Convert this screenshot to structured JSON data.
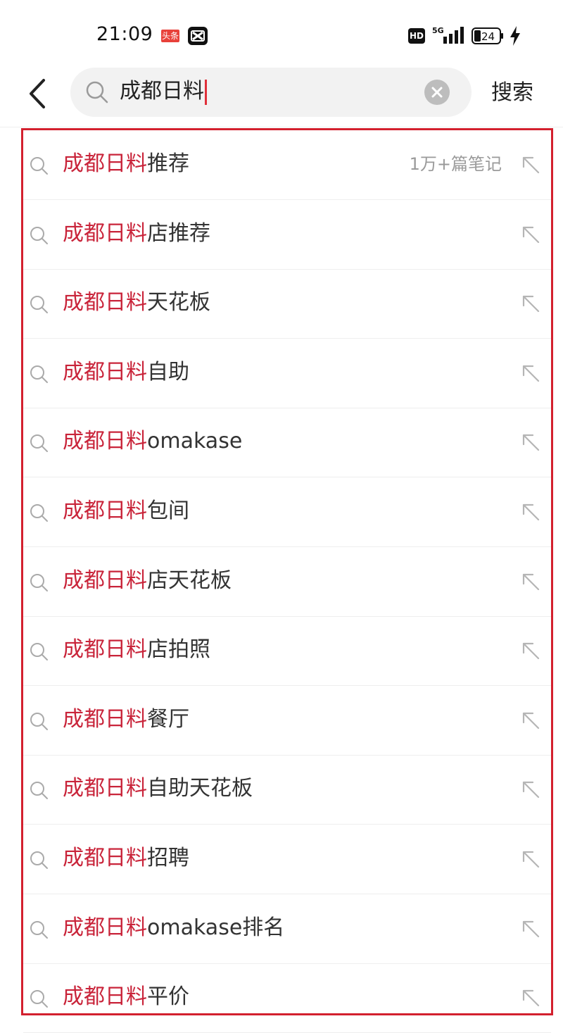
{
  "status_bar": {
    "time": "21:09",
    "toutiao_badge": "头条",
    "network": "5G",
    "hd": "HD",
    "battery": "24"
  },
  "search": {
    "query": "成都日料",
    "button_label": "搜索"
  },
  "suggestions": [
    {
      "highlight": "成都日料",
      "rest": "推荐",
      "count": "1万+篇笔记"
    },
    {
      "highlight": "成都日料",
      "rest": "店推荐",
      "count": ""
    },
    {
      "highlight": "成都日料",
      "rest": "天花板",
      "count": ""
    },
    {
      "highlight": "成都日料",
      "rest": "自助",
      "count": ""
    },
    {
      "highlight": "成都日料",
      "rest": "omakase",
      "count": ""
    },
    {
      "highlight": "成都日料",
      "rest": "包间",
      "count": ""
    },
    {
      "highlight": "成都日料",
      "rest": "店天花板",
      "count": ""
    },
    {
      "highlight": "成都日料",
      "rest": "店拍照",
      "count": ""
    },
    {
      "highlight": "成都日料",
      "rest": "餐厅",
      "count": ""
    },
    {
      "highlight": "成都日料",
      "rest": "自助天花板",
      "count": ""
    },
    {
      "highlight": "成都日料",
      "rest": "招聘",
      "count": ""
    },
    {
      "highlight": "成都日料",
      "rest": "omakase排名",
      "count": ""
    },
    {
      "highlight": "成都日料",
      "rest": "平价",
      "count": ""
    }
  ],
  "colors": {
    "highlight": "#c9243a",
    "outline": "#d3202e",
    "caret": "#e0303a"
  }
}
